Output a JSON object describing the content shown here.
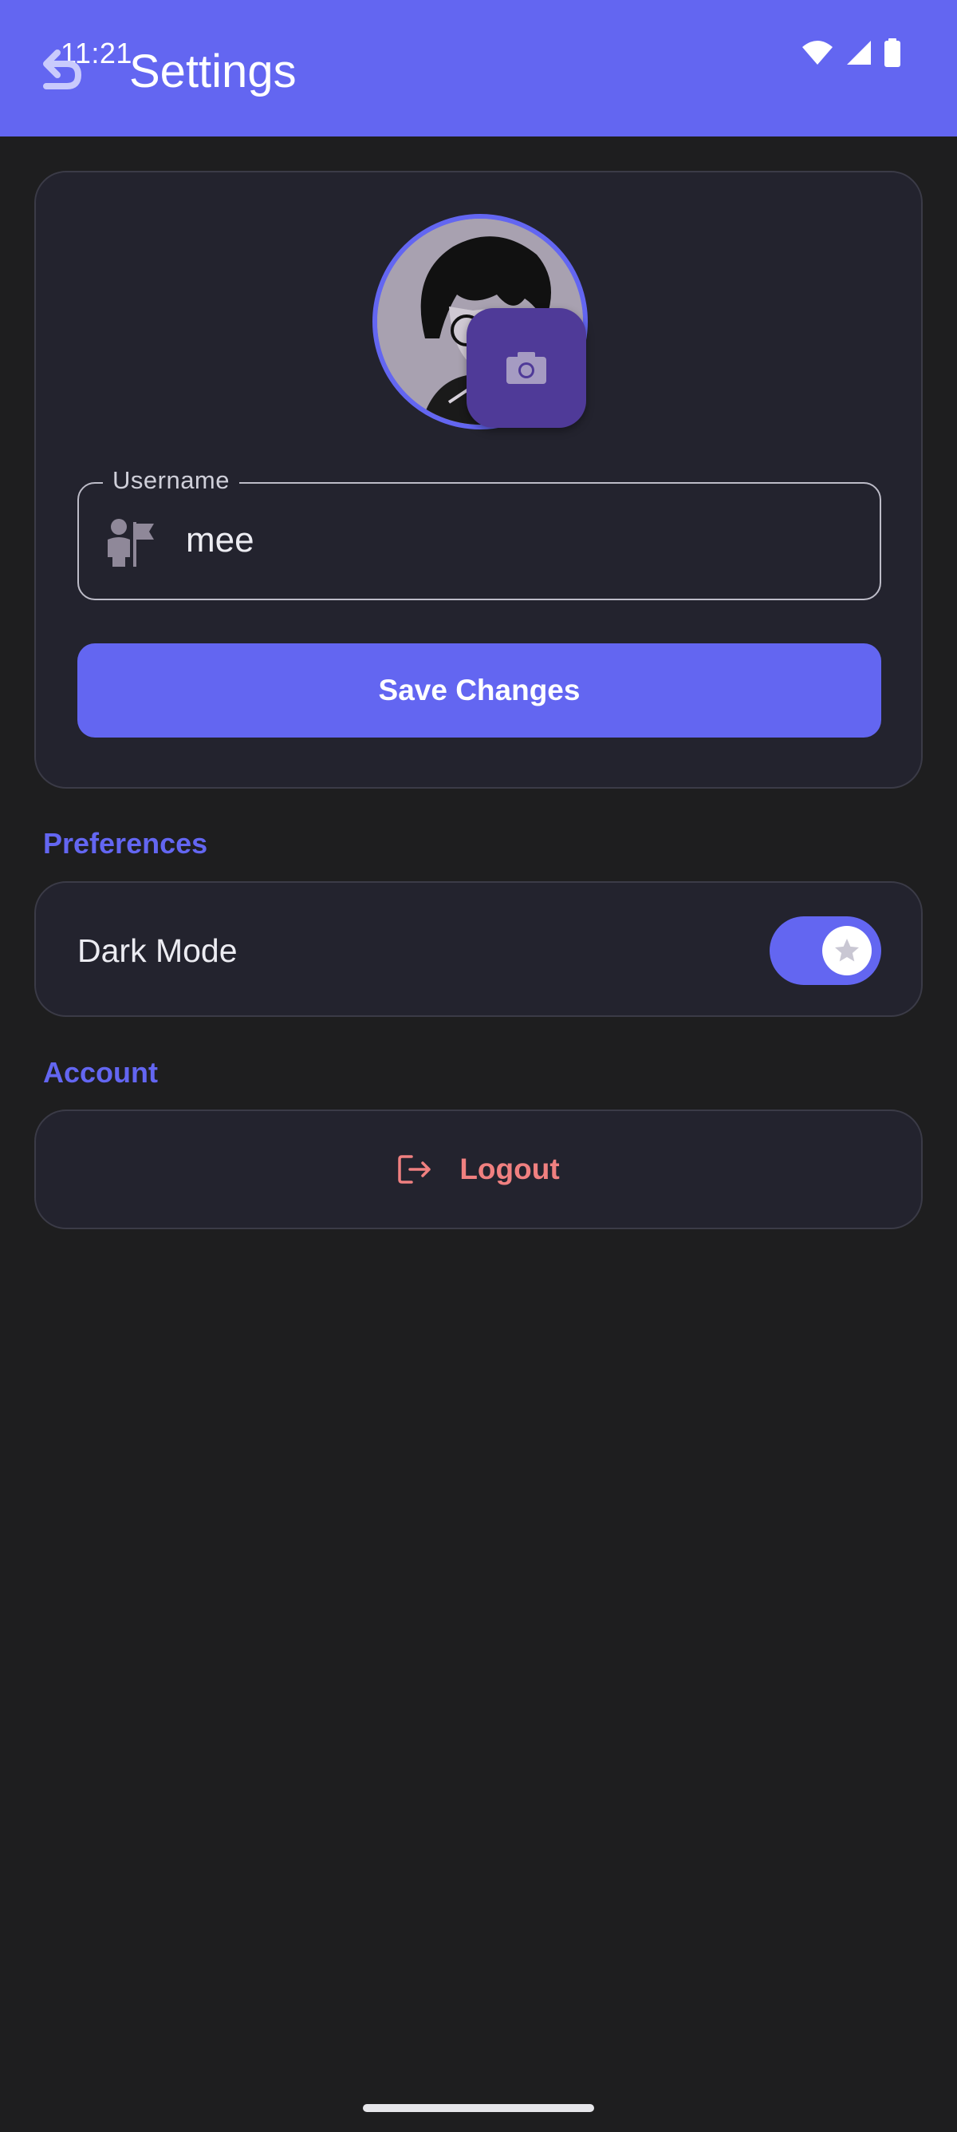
{
  "status_bar": {
    "time": "11:21",
    "icons": [
      "gmail-icon",
      "wifi-icon",
      "signal-icon",
      "battery-icon"
    ]
  },
  "app_bar": {
    "title": "Settings",
    "back_icon": "back-arrow-icon"
  },
  "profile": {
    "avatar_alt": "profile-avatar",
    "camera_icon": "camera-icon",
    "username": {
      "label": "Username",
      "value": "mee",
      "icon": "person-flag-icon"
    },
    "save_label": "Save Changes"
  },
  "preferences": {
    "header": "Preferences",
    "dark_mode": {
      "label": "Dark Mode",
      "enabled": true
    }
  },
  "account": {
    "header": "Account",
    "logout_label": "Logout",
    "logout_icon": "logout-icon"
  },
  "colors": {
    "accent": "#6366f1",
    "background": "#1e1e1f",
    "card": "#23232e",
    "camera_button": "#4f3a98",
    "logout": "#f08080"
  }
}
